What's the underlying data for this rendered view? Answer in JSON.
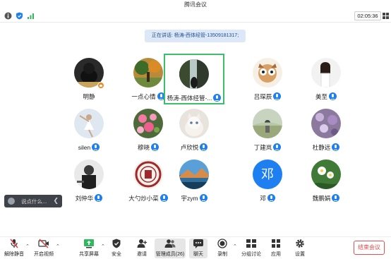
{
  "window": {
    "title": "腾讯会议"
  },
  "status": {
    "timer": "02:05:36"
  },
  "speaking_banner": "正在讲话: 杨涛-西体经管-13509181317;",
  "participants": [
    {
      "name": "明静",
      "avatar": "photo-dark-dog",
      "mic": false,
      "host": true,
      "active": false
    },
    {
      "name": "一点心情",
      "avatar": "photo-trees",
      "mic": true,
      "host": false,
      "active": false
    },
    {
      "name": "杨涛-西体经管-...",
      "avatar": "photo-waterfall",
      "mic": true,
      "host": false,
      "active": true
    },
    {
      "name": "吕琛辰",
      "avatar": "photo-cartoon",
      "mic": true,
      "host": false,
      "active": false
    },
    {
      "name": "美至",
      "avatar": "photo-girl",
      "mic": true,
      "host": false,
      "active": false
    },
    {
      "name": "silen",
      "avatar": "photo-dancer",
      "mic": true,
      "host": false,
      "active": false
    },
    {
      "name": "穆晓",
      "avatar": "photo-flowers",
      "mic": true,
      "host": false,
      "active": false
    },
    {
      "name": "卢欣悦",
      "avatar": "photo-cat",
      "mic": true,
      "host": false,
      "active": false
    },
    {
      "name": "丁建岚",
      "avatar": "photo-field",
      "mic": true,
      "host": false,
      "active": false
    },
    {
      "name": "杜静远",
      "avatar": "photo-purple-flowers",
      "mic": true,
      "host": false,
      "active": false
    },
    {
      "name": "刘仲华",
      "avatar": "photo-man",
      "mic": true,
      "host": false,
      "active": false
    },
    {
      "name": "大勺炒小菜",
      "avatar": "photo-seal",
      "mic": true,
      "host": false,
      "active": false
    },
    {
      "name": "宇zym",
      "avatar": "photo-landscape",
      "mic": true,
      "host": false,
      "active": false
    },
    {
      "name": "邓",
      "avatar": "letter",
      "letter": "邓",
      "mic": true,
      "host": false,
      "active": false
    },
    {
      "name": "魏鹏娟",
      "avatar": "photo-green",
      "mic": true,
      "host": false,
      "active": false
    }
  ],
  "chat": {
    "placeholder": "说点什么..."
  },
  "toolbar": {
    "mute": "解除静音",
    "video": "开启视频",
    "share": "共享屏幕",
    "security": "安全",
    "invite": "邀请",
    "members": "管理成员(26)",
    "chat": "聊天",
    "record": "录制",
    "breakout": "分组讨论",
    "apps": "应用",
    "settings": "设置",
    "end": "结束会议"
  },
  "colors": {
    "accent": "#1e7ff0",
    "active_border": "#3cbf6a",
    "end": "#e04848"
  }
}
